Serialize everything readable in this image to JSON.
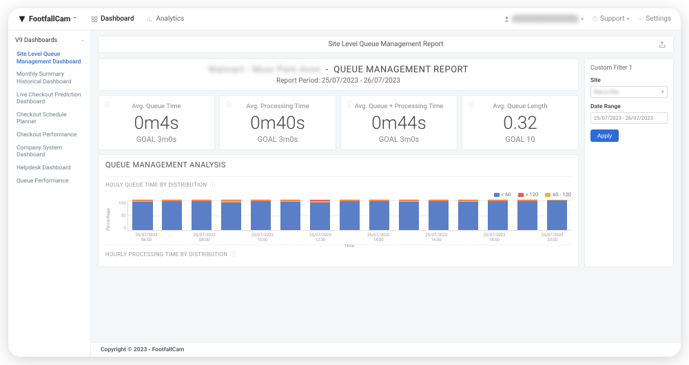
{
  "brand": "FootfallCam",
  "top_tabs": [
    {
      "label": "Dashboard",
      "active": true
    },
    {
      "label": "Analytics",
      "active": false
    }
  ],
  "top_user": "████████████",
  "top_links": {
    "support": "Support",
    "settings": "Settings"
  },
  "sidebar": {
    "heading": "V9 Dashboards",
    "items": [
      "Site Level Queue Management Dashboard",
      "Monthly Summary Historical Dashboard",
      "Live Checkout Prediction Dashboard",
      "Checkout Schedule Planner",
      "Checkout Performance",
      "Company System Dashboard",
      "Helpdesk Dashboard",
      "Queue Performance"
    ],
    "active_index": 0
  },
  "report_bar_title": "Site Level Queue Management Report",
  "header": {
    "prefix_blur": "Walmart - Moor Park Avon",
    "title": "QUEUE MANAGEMENT REPORT",
    "period_label": "Report Period: 25/07/2023 - 26/07/2023"
  },
  "kpis": [
    {
      "label": "Avg. Queue Time",
      "value": "0m4s",
      "goal": "GOAL 3m0s"
    },
    {
      "label": "Avg. Processing Time",
      "value": "0m40s",
      "goal": "GOAL 3m0s"
    },
    {
      "label": "Avg. Queue + Processing Time",
      "value": "0m44s",
      "goal": "GOAL 3m0s"
    },
    {
      "label": "Avg. Queue Length",
      "value": "0.32",
      "goal": "GOAL 10"
    }
  ],
  "analysis_title": "QUEUE MANAGEMENT ANALYSIS",
  "chart1_title": "HOULY QUEUE TIME BY DISTRIBUTION",
  "chart2_title": "HOURLY PROCESSING TIME BY DISTRIBUTION",
  "legend": [
    {
      "label": "< 60",
      "color": "#5b7fc7"
    },
    {
      "label": "> 120",
      "color": "#e85c5c"
    },
    {
      "label": "60 - 120",
      "color": "#f0ad4e"
    }
  ],
  "chart_data": {
    "type": "bar",
    "title": "HOULY QUEUE TIME BY DISTRIBUTION",
    "xlabel": "Time",
    "ylabel": "Percentage",
    "ylim": [
      0,
      100
    ],
    "yticks": [
      0,
      50,
      100
    ],
    "categories": [
      "25/07/2023 06:00",
      "",
      "25/07/2023 08:00",
      "",
      "25/07/2023 10:00",
      "",
      "25/07/2023 12:00",
      "",
      "25/07/2023 14:00",
      "",
      "25/07/2023 16:00",
      "",
      "25/07/2023 18:00",
      "",
      "25/07/2023 20:00"
    ],
    "series": [
      {
        "name": "< 60",
        "color": "#5b7fc7",
        "values": [
          94,
          95,
          96,
          92,
          95,
          94,
          90,
          95,
          96,
          94,
          95,
          93,
          96,
          96,
          97
        ]
      },
      {
        "name": "60 - 120",
        "color": "#f0ad4e",
        "values": [
          4,
          3,
          2,
          5,
          3,
          4,
          6,
          3,
          2,
          4,
          3,
          5,
          2,
          2,
          2
        ]
      },
      {
        "name": "> 120",
        "color": "#e85c5c",
        "values": [
          2,
          2,
          2,
          3,
          2,
          2,
          4,
          2,
          2,
          2,
          2,
          2,
          2,
          2,
          1
        ]
      }
    ]
  },
  "filter": {
    "heading": "Custom Filter 1",
    "site_label": "Site",
    "site_value": "Site to Site",
    "date_label": "Date Range",
    "date_value": "25/07/2023 - 26/07/2023",
    "apply": "Apply"
  },
  "footer": "Copyright © 2023 - FootfallCam"
}
